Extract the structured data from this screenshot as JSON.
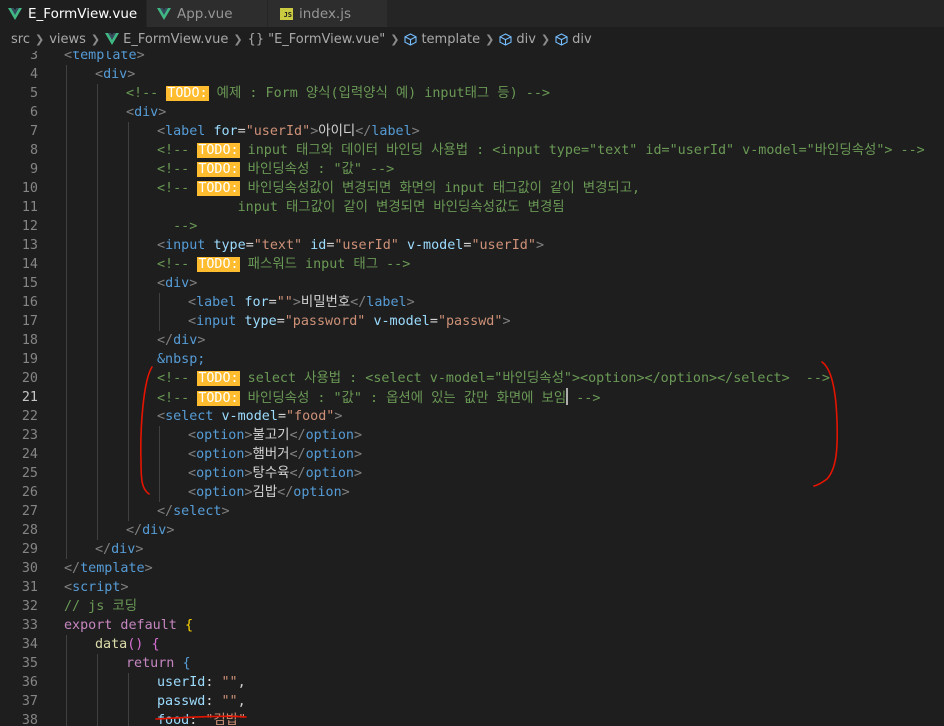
{
  "tabs": [
    {
      "label": "E_FormView.vue",
      "icon": "vue-icon",
      "active": true,
      "modified": true
    },
    {
      "label": "App.vue",
      "icon": "vue-icon",
      "active": false
    },
    {
      "label": "index.js",
      "icon": "js-icon",
      "active": false
    }
  ],
  "breadcrumb": {
    "src": "src",
    "views": "views",
    "file": "E_FormView.vue",
    "component": "\"E_FormView.vue\"",
    "template": "template",
    "div1": "div",
    "div2": "div",
    "component_glyph": "{}"
  },
  "js_badge": "JS",
  "editor": {
    "current_line": 21,
    "lines": [
      {
        "n": "3",
        "segs": [
          [
            "punc",
            "<"
          ],
          [
            "tag",
            "template"
          ],
          [
            "punc",
            ">"
          ]
        ],
        "indent": 0
      },
      {
        "n": "4",
        "segs": [
          [
            "punc",
            "<"
          ],
          [
            "tag",
            "div"
          ],
          [
            "punc",
            ">"
          ]
        ],
        "indent": 1
      },
      {
        "n": "5",
        "segs": [
          [
            "cmt",
            "<!-- "
          ],
          [
            "todo",
            "TODO:"
          ],
          [
            "cmt",
            " 예제 : Form 양식(입력양식 예) input태그 등) -->"
          ]
        ],
        "indent": 2
      },
      {
        "n": "6",
        "segs": [
          [
            "punc",
            "<"
          ],
          [
            "tag",
            "div"
          ],
          [
            "punc",
            ">"
          ]
        ],
        "indent": 2
      },
      {
        "n": "7",
        "segs": [
          [
            "punc",
            "<"
          ],
          [
            "tag",
            "label "
          ],
          [
            "attr",
            "for"
          ],
          [
            "txt",
            "="
          ],
          [
            "str",
            "\"userId\""
          ],
          [
            "punc",
            ">"
          ],
          [
            "txt",
            "아이디"
          ],
          [
            "punc",
            "</"
          ],
          [
            "tag",
            "label"
          ],
          [
            "punc",
            ">"
          ]
        ],
        "indent": 3
      },
      {
        "n": "8",
        "segs": [
          [
            "cmt",
            "<!-- "
          ],
          [
            "todo",
            "TODO:"
          ],
          [
            "cmt",
            " input 태그와 데이터 바인딩 사용법 : <input type=\"text\" id=\"userId\" v-model=\"바인딩속성\"> -->"
          ]
        ],
        "indent": 3
      },
      {
        "n": "9",
        "segs": [
          [
            "cmt",
            "<!-- "
          ],
          [
            "todo",
            "TODO:"
          ],
          [
            "cmt",
            " 바인딩속성 : \"값\" -->"
          ]
        ],
        "indent": 3
      },
      {
        "n": "10",
        "segs": [
          [
            "cmt",
            "<!-- "
          ],
          [
            "todo",
            "TODO:"
          ],
          [
            "cmt",
            " 바인딩속성값이 변경되면 화면의 input 태그값이 같이 변경되고,"
          ]
        ],
        "indent": 3
      },
      {
        "n": "11",
        "segs": [
          [
            "cmt",
            "          input 태그값이 같이 변경되면 바인딩속성값도 변경됨"
          ]
        ],
        "indent": 3
      },
      {
        "n": "12",
        "segs": [
          [
            "cmt",
            "  -->"
          ]
        ],
        "indent": 3
      },
      {
        "n": "13",
        "segs": [
          [
            "punc",
            "<"
          ],
          [
            "tag",
            "input "
          ],
          [
            "attr",
            "type"
          ],
          [
            "txt",
            "="
          ],
          [
            "str",
            "\"text\""
          ],
          [
            "txt",
            " "
          ],
          [
            "attr",
            "id"
          ],
          [
            "txt",
            "="
          ],
          [
            "str",
            "\"userId\""
          ],
          [
            "txt",
            " "
          ],
          [
            "attr",
            "v-model"
          ],
          [
            "txt",
            "="
          ],
          [
            "str",
            "\"userId\""
          ],
          [
            "punc",
            ">"
          ]
        ],
        "indent": 3
      },
      {
        "n": "14",
        "segs": [
          [
            "cmt",
            "<!-- "
          ],
          [
            "todo",
            "TODO:"
          ],
          [
            "cmt",
            " 패스워드 input 태그 -->"
          ]
        ],
        "indent": 3
      },
      {
        "n": "15",
        "segs": [
          [
            "punc",
            "<"
          ],
          [
            "tag",
            "div"
          ],
          [
            "punc",
            ">"
          ]
        ],
        "indent": 3
      },
      {
        "n": "16",
        "segs": [
          [
            "punc",
            "<"
          ],
          [
            "tag",
            "label "
          ],
          [
            "attr",
            "for"
          ],
          [
            "txt",
            "="
          ],
          [
            "str",
            "\"\""
          ],
          [
            "punc",
            ">"
          ],
          [
            "txt",
            "비밀번호"
          ],
          [
            "punc",
            "</"
          ],
          [
            "tag",
            "label"
          ],
          [
            "punc",
            ">"
          ]
        ],
        "indent": 4
      },
      {
        "n": "17",
        "segs": [
          [
            "punc",
            "<"
          ],
          [
            "tag",
            "input "
          ],
          [
            "attr",
            "type"
          ],
          [
            "txt",
            "="
          ],
          [
            "str",
            "\"password\""
          ],
          [
            "txt",
            " "
          ],
          [
            "attr",
            "v-model"
          ],
          [
            "txt",
            "="
          ],
          [
            "str",
            "\"passwd\""
          ],
          [
            "punc",
            ">"
          ]
        ],
        "indent": 4
      },
      {
        "n": "18",
        "segs": [
          [
            "punc",
            "</"
          ],
          [
            "tag",
            "div"
          ],
          [
            "punc",
            ">"
          ]
        ],
        "indent": 3
      },
      {
        "n": "19",
        "segs": [
          [
            "tag",
            "&nbsp;"
          ]
        ],
        "indent": 3
      },
      {
        "n": "20",
        "segs": [
          [
            "cmt",
            "<!-- "
          ],
          [
            "todo",
            "TODO:"
          ],
          [
            "cmt",
            " select 사용법 : <select v-model=\"바인딩속성\"><option></option></select>  -->"
          ]
        ],
        "indent": 3
      },
      {
        "n": "21",
        "segs": [
          [
            "cmt",
            "<!-- "
          ],
          [
            "todo",
            "TODO:"
          ],
          [
            "cmt",
            " 바인딩속성 : \"값\" : 옵션에 있는 값만 화면에 보임"
          ],
          [
            "caret",
            ""
          ],
          [
            "cmt",
            " -->"
          ]
        ],
        "indent": 3
      },
      {
        "n": "22",
        "segs": [
          [
            "punc",
            "<"
          ],
          [
            "tag",
            "select "
          ],
          [
            "attr",
            "v-model"
          ],
          [
            "txt",
            "="
          ],
          [
            "str",
            "\"food\""
          ],
          [
            "punc",
            ">"
          ]
        ],
        "indent": 3
      },
      {
        "n": "23",
        "segs": [
          [
            "punc",
            "<"
          ],
          [
            "tag",
            "option"
          ],
          [
            "punc",
            ">"
          ],
          [
            "txt",
            "불고기"
          ],
          [
            "punc",
            "</"
          ],
          [
            "tag",
            "option"
          ],
          [
            "punc",
            ">"
          ]
        ],
        "indent": 4
      },
      {
        "n": "24",
        "segs": [
          [
            "punc",
            "<"
          ],
          [
            "tag",
            "option"
          ],
          [
            "punc",
            ">"
          ],
          [
            "txt",
            "햄버거"
          ],
          [
            "punc",
            "</"
          ],
          [
            "tag",
            "option"
          ],
          [
            "punc",
            ">"
          ]
        ],
        "indent": 4
      },
      {
        "n": "25",
        "segs": [
          [
            "punc",
            "<"
          ],
          [
            "tag",
            "option"
          ],
          [
            "punc",
            ">"
          ],
          [
            "txt",
            "탕수육"
          ],
          [
            "punc",
            "</"
          ],
          [
            "tag",
            "option"
          ],
          [
            "punc",
            ">"
          ]
        ],
        "indent": 4
      },
      {
        "n": "26",
        "segs": [
          [
            "punc",
            "<"
          ],
          [
            "tag",
            "option"
          ],
          [
            "punc",
            ">"
          ],
          [
            "txt",
            "김밥"
          ],
          [
            "punc",
            "</"
          ],
          [
            "tag",
            "option"
          ],
          [
            "punc",
            ">"
          ]
        ],
        "indent": 4
      },
      {
        "n": "27",
        "segs": [
          [
            "punc",
            "</"
          ],
          [
            "tag",
            "select"
          ],
          [
            "punc",
            ">"
          ]
        ],
        "indent": 3
      },
      {
        "n": "28",
        "segs": [
          [
            "punc",
            "</"
          ],
          [
            "tag",
            "div"
          ],
          [
            "punc",
            ">"
          ]
        ],
        "indent": 2
      },
      {
        "n": "29",
        "segs": [
          [
            "punc",
            "</"
          ],
          [
            "tag",
            "div"
          ],
          [
            "punc",
            ">"
          ]
        ],
        "indent": 1
      },
      {
        "n": "30",
        "segs": [
          [
            "punc",
            "</"
          ],
          [
            "tag",
            "template"
          ],
          [
            "punc",
            ">"
          ]
        ],
        "indent": 0
      },
      {
        "n": "31",
        "segs": [
          [
            "punc",
            "<"
          ],
          [
            "tag",
            "script"
          ],
          [
            "punc",
            ">"
          ]
        ],
        "indent": 0
      },
      {
        "n": "32",
        "segs": [
          [
            "cmt",
            "// js 코딩"
          ]
        ],
        "indent": 0
      },
      {
        "n": "33",
        "segs": [
          [
            "kw",
            "export default "
          ],
          [
            "br",
            "{"
          ]
        ],
        "indent": 0
      },
      {
        "n": "34",
        "segs": [
          [
            "fn",
            "data"
          ],
          [
            "br2",
            "()"
          ],
          [
            "txt",
            " "
          ],
          [
            "br2",
            "{"
          ]
        ],
        "indent": 1
      },
      {
        "n": "35",
        "segs": [
          [
            "kw",
            "return "
          ],
          [
            "tag",
            "{"
          ]
        ],
        "indent": 2
      },
      {
        "n": "36",
        "segs": [
          [
            "attr",
            "userId"
          ],
          [
            "txt",
            ": "
          ],
          [
            "str",
            "\"\""
          ],
          [
            "txt",
            ","
          ]
        ],
        "indent": 3
      },
      {
        "n": "37",
        "segs": [
          [
            "attr",
            "passwd"
          ],
          [
            "txt",
            ": "
          ],
          [
            "str",
            "\"\""
          ],
          [
            "txt",
            ","
          ]
        ],
        "indent": 3
      },
      {
        "n": "38",
        "segs": [
          [
            "attr",
            "food"
          ],
          [
            "txt",
            ": "
          ],
          [
            "str",
            "\"김밥\""
          ]
        ],
        "indent": 3
      }
    ]
  },
  "colors": {
    "vue_green": "#41b883",
    "todo_highlight": "#ffbc2e",
    "annotation_red": "#e51400"
  }
}
